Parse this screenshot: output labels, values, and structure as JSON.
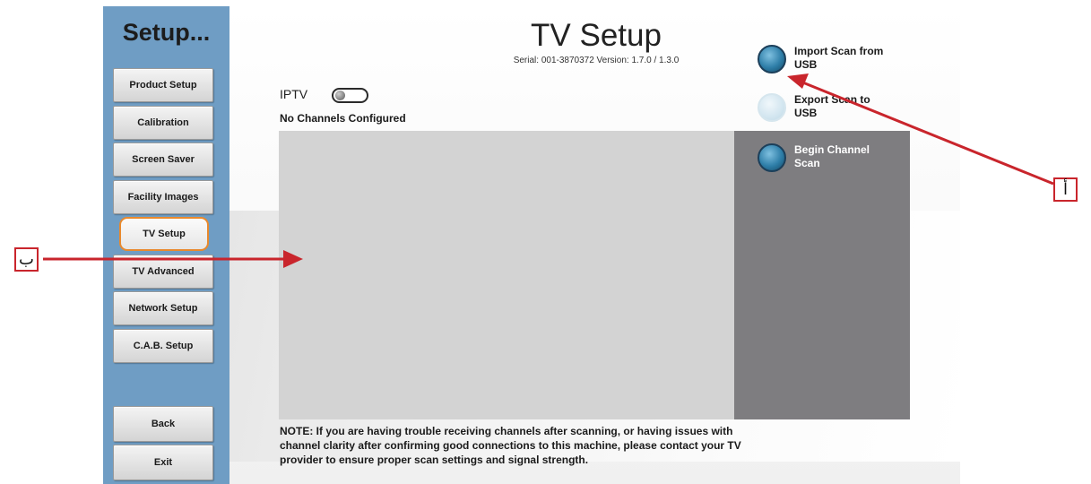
{
  "sidebar": {
    "title": "Setup...",
    "items": [
      {
        "label": "Product Setup"
      },
      {
        "label": "Calibration"
      },
      {
        "label": "Screen Saver"
      },
      {
        "label": "Facility Images"
      },
      {
        "label": "TV Setup",
        "active": true
      },
      {
        "label": "TV Advanced"
      },
      {
        "label": "Network Setup"
      },
      {
        "label": "C.A.B. Setup"
      }
    ],
    "back_label": "Back",
    "exit_label": "Exit"
  },
  "header": {
    "title": "TV Setup",
    "serial": "Serial: 001-3870372  Version: 1.7.0 / 1.3.0"
  },
  "iptv": {
    "label": "IPTV",
    "enabled": false
  },
  "channels": {
    "status": "No Channels Configured"
  },
  "actions": {
    "import_label": "Import Scan from USB",
    "export_label": "Export Scan to USB",
    "scan_label": "Begin Channel Scan"
  },
  "note": "NOTE: If you are having trouble receiving channels after scanning, or having issues with channel clarity after confirming good connections to this machine, please contact your TV provider to ensure proper scan settings and signal strength.",
  "callouts": {
    "a": "أ",
    "b": "ب"
  },
  "colors": {
    "sidebar": "#6f9dc4",
    "active_outline": "#e9892c",
    "callout": "#c9252c",
    "right_panel": "#7e7d80",
    "channel_list": "#d3d3d3"
  }
}
